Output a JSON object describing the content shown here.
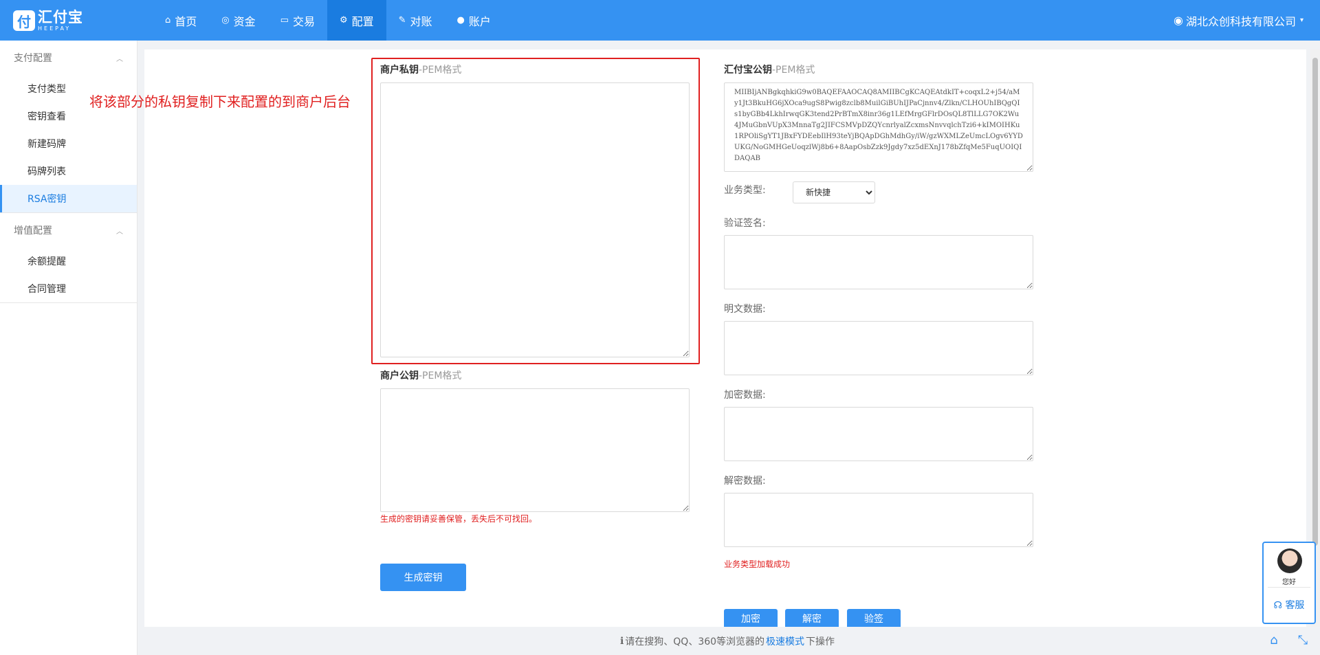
{
  "brand": {
    "logo_glyph": "付",
    "name": "汇付宝",
    "name_en": "HEEPAY"
  },
  "nav": {
    "items": [
      {
        "icon": "⌂",
        "label": "首页"
      },
      {
        "icon": "◎",
        "label": "资金"
      },
      {
        "icon": "▭",
        "label": "交易"
      },
      {
        "icon": "⚙",
        "label": "配置"
      },
      {
        "icon": "✎",
        "label": "对账"
      },
      {
        "icon": "●",
        "label": "账户"
      }
    ],
    "active": "配置",
    "company": "湖北众创科技有限公司",
    "company_caret": "▾",
    "user_icon": "◉"
  },
  "sidebar": {
    "groups": [
      {
        "label": "支付配置",
        "chevron": "︿",
        "items": [
          "支付类型",
          "密钥查看",
          "新建码牌",
          "码牌列表",
          "RSA密钥"
        ]
      },
      {
        "label": "增值配置",
        "chevron": "︿",
        "items": [
          "余额提醒",
          "合同管理"
        ]
      }
    ],
    "active_item": "RSA密钥"
  },
  "annotation": "将该部分的私钥复制下来配置的到商户后台",
  "left": {
    "private_key": {
      "title": "商户私钥",
      "suffix": "-PEM格式",
      "value": ""
    },
    "public_key": {
      "title": "商户公钥",
      "suffix": "-PEM格式",
      "value": ""
    },
    "warning": "生成的密钥请妥善保管，丢失后不可找回。",
    "generate_button": "生成密钥"
  },
  "right": {
    "heepay_pub": {
      "title": "汇付宝公钥",
      "suffix": "-PEM格式",
      "value": "MIIBIjANBgkqhkiG9w0BAQEFAAOCAQ8AMIIBCgKCAQEAtdkIT+coqxL2+j54/aMy1Jt3BkuHG6jXOca9ugS8Pwig8zclb8MuilGiBUhIJPaCjnnv4/Zlkn/CLHOUhIBQgQIs1byGBb4LkhIrwqGK3tend2PrBTmX8inr36g1LEfMrgGFlrDOsQL8TlLLG7OK2Wu4JMuGbnVUpX3MnnaTg2JIFCSMVpDZQYcnrlyalZcxmsNnvvqlchTzi6+kIMOIHKu1RPOliSgYT1JBxFYDEebIlH93teYjBQApDGhMdhGy/iW/gzWXMLZeUmcLOgv6YYDUKG/NoGMHGeUoqzlWj8b6+8AapOsbZzk9Jgdy7xz5dEXnJ178bZfqMe5FuqUOIQIDAQAB"
    },
    "biz_type": {
      "label": "业务类型:",
      "selected": "新快捷"
    },
    "verify_sign": {
      "label": "验证签名:",
      "value": ""
    },
    "plain_data": {
      "label": "明文数据:",
      "value": ""
    },
    "encrypted_data": {
      "label": "加密数据:",
      "value": ""
    },
    "decrypted_data": {
      "label": "解密数据:",
      "value": ""
    },
    "status": "业务类型加载成功",
    "buttons": {
      "encrypt": "加密",
      "decrypt": "解密",
      "verify": "验签"
    }
  },
  "footer": {
    "info_icon": "ℹ",
    "prefix": "请在搜狗、QQ、360等浏览器的",
    "link": "极速模式",
    "suffix": "下操作"
  },
  "cs_widget": {
    "greeting": "您好",
    "service_icon": "☊",
    "service_label": "客服",
    "home_icon": "⌂",
    "collapse_icon": "⤡"
  },
  "colors": {
    "primary": "#3592f2",
    "nav_active": "#1a7ce0",
    "annotation_red": "#e02020"
  }
}
